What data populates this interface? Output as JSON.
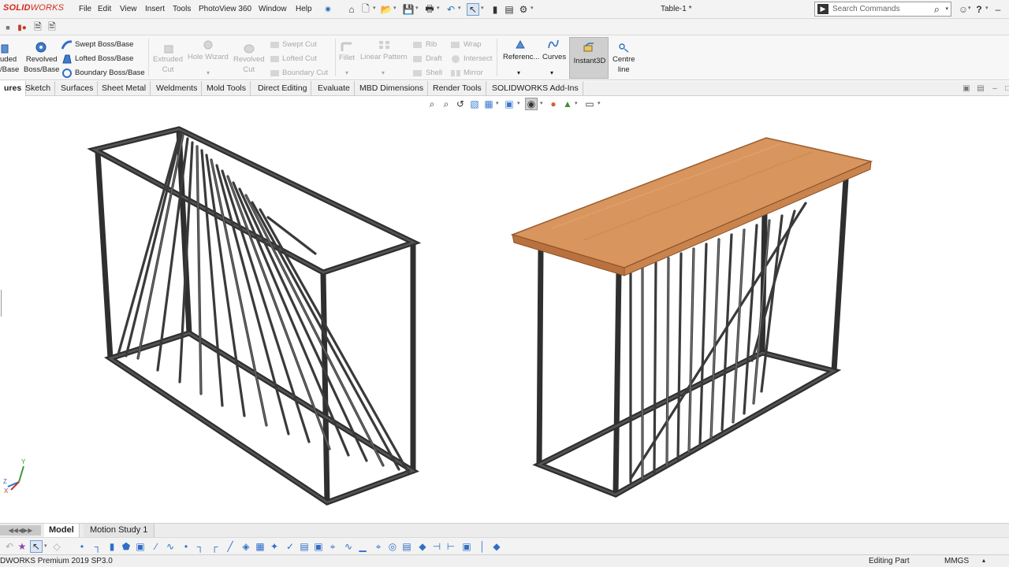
{
  "app": {
    "logo_text_1": "SOLID",
    "logo_text_2": "WORKS",
    "document_title": "Table-1 *"
  },
  "menu": [
    "File",
    "Edit",
    "View",
    "Insert",
    "Tools",
    "PhotoView 360",
    "Window",
    "Help"
  ],
  "search": {
    "placeholder": "Search Commands"
  },
  "command_manager": {
    "extruded_1": "uded",
    "extruded_2": "/Base",
    "revolved_1": "Revolved",
    "revolved_2": "Boss/Base",
    "swept": "Swept Boss/Base",
    "lofted": "Lofted Boss/Base",
    "boundary": "Boundary Boss/Base",
    "extruded_cut_1": "Extruded",
    "extruded_cut_2": "Cut",
    "hole_wizard": "Hole Wizard",
    "revolved_cut_1": "Revolved",
    "revolved_cut_2": "Cut",
    "swept_cut": "Swept Cut",
    "lofted_cut": "Lofted Cut",
    "boundary_cut": "Boundary Cut",
    "fillet": "Fillet",
    "linear_pattern": "Linear Pattern",
    "rib": "Rib",
    "draft": "Draft",
    "shell": "Shell",
    "wrap": "Wrap",
    "intersect": "Intersect",
    "mirror": "Mirror",
    "reference": "Referenc...",
    "curves": "Curves",
    "instant3d": "Instant3D",
    "centre_1": "Centre",
    "centre_2": "line"
  },
  "tabs": [
    "ures",
    "Sketch",
    "Surfaces",
    "Sheet Metal",
    "Weldments",
    "Mold Tools",
    "Direct Editing",
    "Evaluate",
    "MBD Dimensions",
    "Render Tools",
    "SOLIDWORKS Add-Ins"
  ],
  "active_tab_index": 0,
  "bottom_tabs": [
    "Model",
    "Motion Study 1"
  ],
  "status": {
    "version": "DWORKS Premium 2019 SP3.0",
    "mode": "Editing Part",
    "units": "MMGS"
  },
  "triad": {
    "x": "X",
    "y": "Y",
    "z": "Z"
  },
  "colors": {
    "frame_steel": "#2f2f2f",
    "table_top_wood": "#d8955e",
    "logo_red": "#d52b1e",
    "instant3d_active": "#cfcfcf"
  }
}
